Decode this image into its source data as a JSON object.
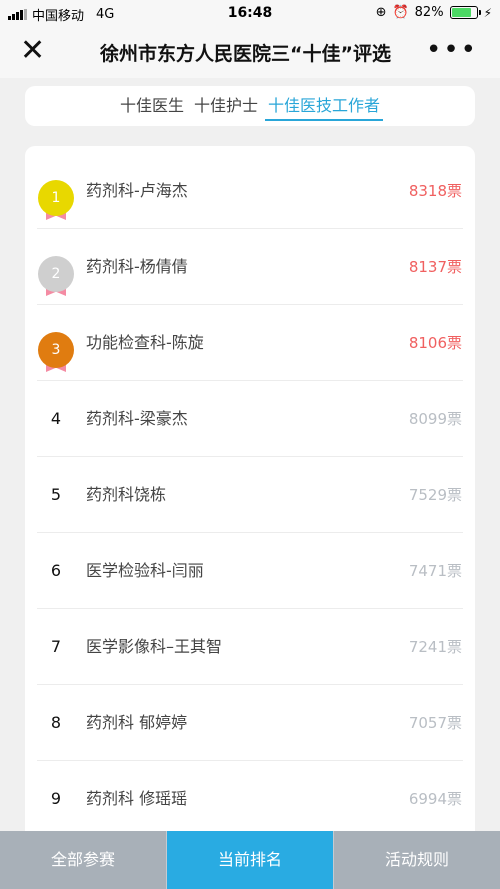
{
  "status_bar": {
    "carrier": "中国移动",
    "network": "4G",
    "time": "16:48",
    "battery": "82%",
    "battery_level": 0.82
  },
  "nav": {
    "title": "徐州市东方人民医院三“十佳”评选",
    "close_icon": "close-icon",
    "more_icon": "more-icon"
  },
  "tabs": [
    {
      "label": "十佳医生"
    },
    {
      "label": "十佳护士"
    },
    {
      "label": "十佳医技工作者"
    }
  ],
  "active_tab": 2,
  "rankings": [
    {
      "rank": "1",
      "name": "药剂科-卢海杰",
      "votes": "8318票",
      "medal": "gold"
    },
    {
      "rank": "2",
      "name": "药剂科-杨倩倩",
      "votes": "8137票",
      "medal": "silver"
    },
    {
      "rank": "3",
      "name": "功能检查科-陈旋",
      "votes": "8106票",
      "medal": "bronze"
    },
    {
      "rank": "4",
      "name": "药剂科-梁豪杰",
      "votes": "8099票"
    },
    {
      "rank": "5",
      "name": "药剂科饶栋",
      "votes": "7529票"
    },
    {
      "rank": "6",
      "name": "医学检验科-闫丽",
      "votes": "7471票"
    },
    {
      "rank": "7",
      "name": "医学影像科–王其智",
      "votes": "7241票"
    },
    {
      "rank": "8",
      "name": "药剂科 郁婷婷",
      "votes": "7057票"
    },
    {
      "rank": "9",
      "name": "药剂科 修瑶瑶",
      "votes": "6994票"
    }
  ],
  "colors": {
    "accent": "#29abe2",
    "top_votes": "#f06060",
    "gold": "#e8d800",
    "silver": "#cfcfcf",
    "bronze": "#e07c10"
  },
  "bottom_bar": [
    {
      "label": "全部参赛"
    },
    {
      "label": "当前排名"
    },
    {
      "label": "活动规则"
    }
  ],
  "active_bottom": 1
}
